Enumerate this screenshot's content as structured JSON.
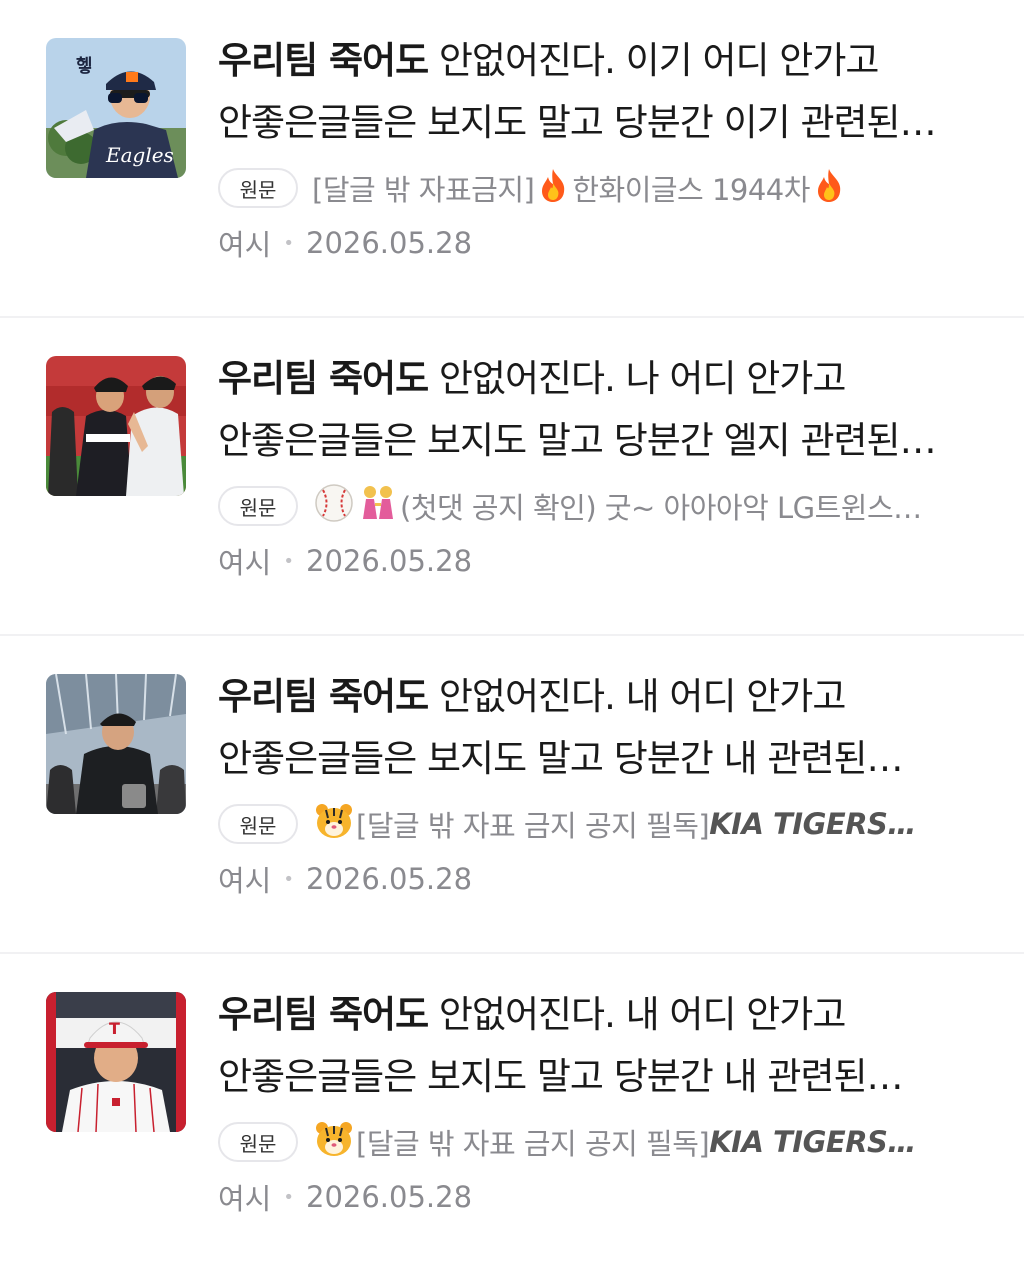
{
  "posts": [
    {
      "title_emph": "우리팀 죽어도",
      "title_rest": " 안없어진다. 이기 어디 안가고",
      "title_line2": "안좋은글들은 보지도 말고 당분간 이기 관련된…",
      "badge": "원문",
      "source_pre": "[달글 밖 자표금지] ",
      "source_mid": "한화이글스 1944차",
      "source_brand": "",
      "icon": "fire-icon",
      "author": "여시",
      "date": "2026.05.28"
    },
    {
      "title_emph": "우리팀 죽어도",
      "title_rest": " 안없어진다. 나 어디 안가고",
      "title_line2": "안좋은글들은 보지도 말고 당분간 엘지 관련된…",
      "badge": "원문",
      "source_pre": "",
      "source_mid": "(첫댓 공지 확인) 굿~ 아아아악 LG트윈스…",
      "source_brand": "",
      "icon": "baseball-icon",
      "author": "여시",
      "date": "2026.05.28"
    },
    {
      "title_emph": "우리팀 죽어도",
      "title_rest": " 안없어진다. 내 어디 안가고",
      "title_line2": "안좋은글들은 보지도 말고 당분간 내 관련된…",
      "badge": "원문",
      "source_pre": "",
      "source_mid": "[달글 밖 자표 금지 공지 필독] ",
      "source_brand": "KIA TIGERS…",
      "icon": "tiger-icon",
      "author": "여시",
      "date": "2026.05.28"
    },
    {
      "title_emph": "우리팀 죽어도",
      "title_rest": " 안없어진다. 내 어디 안가고",
      "title_line2": "안좋은글들은 보지도 말고 당분간 내 관련된…",
      "badge": "원문",
      "source_pre": "",
      "source_mid": "[달글 밖 자표 금지 공지 필독] ",
      "source_brand": "KIA TIGERS…",
      "icon": "tiger-icon",
      "author": "여시",
      "date": "2026.05.28"
    }
  ],
  "thumb_labels": {
    "eagles_badge": "헿",
    "eagles_jersey": "Eagles",
    "lg_cap": "T"
  },
  "colors": {
    "fire": "#ff6a1a",
    "muted": "#8a8a8f",
    "border": "#f1f1f3"
  }
}
